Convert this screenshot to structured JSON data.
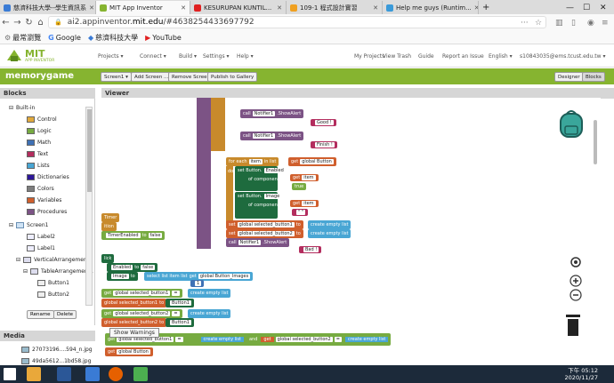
{
  "browser": {
    "tabs": [
      {
        "label": "慈濟科技大學--學生資訊系"
      },
      {
        "label": "MIT App Inventor"
      },
      {
        "label": "KESURUPAN KUNTIL..."
      },
      {
        "label": "109-1 程式設計實習"
      },
      {
        "label": "Help me guys (Runtim..."
      }
    ],
    "url_prefix": "ai2.appinventor.",
    "url_domain": "mit.edu",
    "url_suffix": "/#4638254433697792",
    "bookmarks": [
      "最常瀏覽",
      "Google",
      "慈濟科技大學",
      "YouTube"
    ]
  },
  "appinventor": {
    "logo_text": "MIT",
    "logo_sub": "APP INVENTOR",
    "menus": [
      "Projects ▾",
      "Connect ▾",
      "Build ▾",
      "Settings ▾",
      "Help ▾"
    ],
    "right_menus": [
      "My Projects",
      "View Trash",
      "Guide",
      "Report an Issue",
      "English ▾",
      "s10843035@ems.tcust.edu.tw ▾"
    ],
    "project_name": "memorygame",
    "screen_select": "Screen1 ▾",
    "add_screen": "Add Screen ...",
    "remove_screen": "Remove Screen",
    "publish": "Publish to Gallery",
    "designer": "Designer",
    "blocks_btn": "Blocks"
  },
  "blocks_panel": {
    "title": "Blocks",
    "builtin": "Built-in",
    "builtin_items": [
      "Control",
      "Logic",
      "Math",
      "Text",
      "Lists",
      "Dictionaries",
      "Colors",
      "Variables",
      "Procedures"
    ],
    "builtin_colors": [
      "#e1a93c",
      "#77ab41",
      "#3f71b5",
      "#b32d5e",
      "#49a6d4",
      "#2d1799",
      "#7d7d7d",
      "#d05f2d",
      "#7c5385"
    ],
    "screen": "Screen1",
    "components": [
      "Label2",
      "Label1",
      "VerticalArrangement1",
      "TableArrangement1",
      "Button1",
      "Button2"
    ],
    "rename": "Rename",
    "delete": "Delete"
  },
  "media_panel": {
    "title": "Media",
    "files": [
      "27073196....594_n.jpg",
      "49da5612...1bd58.jpg"
    ]
  },
  "viewer": {
    "title": "Viewer",
    "tooltip": "Show Warnings",
    "warning_count": "0",
    "error_count": "0"
  },
  "code": {
    "call": "call",
    "notifier": "Notifier1",
    "showalert": ".ShowAlert",
    "notice": "notice",
    "good": "Good !",
    "finish": "Finish !",
    "bad": "Bad !",
    "else": "else",
    "foreach": "for each",
    "item": "item",
    "inlist": "in list",
    "get": "get",
    "global_button": "global Button",
    "do": "do",
    "set_button": "set Button.",
    "enabled": "Enabled",
    "of_component": "of component",
    "to": "to",
    "true": "true",
    "false": "false",
    "image": "Image",
    "empty": "\" \"",
    "set": "set",
    "sel1": "global selected_button1",
    "sel2": "global selected_button2",
    "create_empty_list": "create empty list",
    "timer": "Timer",
    "timer_enabled": "TimerEnabled",
    "select_list_item": "select list item  list",
    "global_button_images": "global Button_Images",
    "index": "index",
    "and": "and",
    "button1": "Button1",
    "eq": "="
  },
  "taskbar": {
    "time": "下午 05:12",
    "date": "2020/11/27"
  }
}
